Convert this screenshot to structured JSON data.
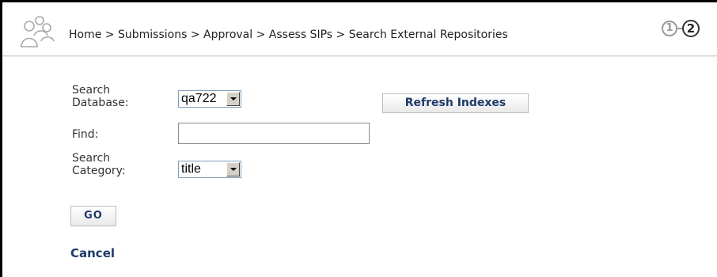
{
  "breadcrumb": {
    "items": [
      "Home",
      "Submissions",
      "Approval",
      "Assess SIPs",
      "Search External Repositories"
    ],
    "separator": " > "
  },
  "steps": {
    "step1": "1",
    "step2": "2"
  },
  "form": {
    "database_label_line1": "Search",
    "database_label_line2": "Database:",
    "database_value": "qa722",
    "find_label": "Find:",
    "find_value": "",
    "category_label_line1": "Search",
    "category_label_line2": "Category:",
    "category_value": "title"
  },
  "buttons": {
    "refresh_label": "Refresh Indexes",
    "go_label": "GO",
    "cancel_label": "Cancel"
  },
  "icons": {
    "logo": "people-group-icon",
    "dropdown": "chevron-down-icon"
  },
  "colors": {
    "link": "#1f3a6a",
    "text": "#333333",
    "border": "#000000"
  }
}
